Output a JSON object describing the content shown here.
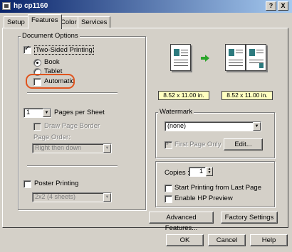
{
  "window": {
    "title": "hp cp1160",
    "help_button": "?",
    "close_button": "X"
  },
  "tabs": [
    {
      "label": "Setup",
      "active": false
    },
    {
      "label": "Features",
      "active": true
    },
    {
      "label": "Color",
      "active": false
    },
    {
      "label": "Services",
      "active": false
    }
  ],
  "document_options": {
    "legend": "Document Options",
    "two_sided_label": "Two-Sided Printing",
    "two_sided_checked": true,
    "book_label": "Book",
    "tablet_label": "Tablet",
    "automatic_label": "Automatic",
    "pages_per_sheet_value": "1",
    "pages_per_sheet_label": "Pages per Sheet",
    "draw_borders_label": "Draw Page Border",
    "page_order_label": "Page Order:",
    "page_order_value": "Right then down",
    "poster_label": "Poster Printing",
    "poster_value": "2x2 (4 sheets)"
  },
  "preview": {
    "size_left": "8.52 x 11.00 in.",
    "size_right": "8.52 x 11.00 in.",
    "arrow_color": "#2aa52a",
    "highlight_color": "#e0541e"
  },
  "watermark": {
    "legend": "Watermark",
    "value": "(none)",
    "first_page_label": "First Page Only",
    "edit_label": "Edit..."
  },
  "copies": {
    "label": "Copies :",
    "value": "1",
    "start_last_label": "Start Printing from Last Page",
    "hp_preview_label": "Enable HP Preview"
  },
  "buttons": {
    "advanced": "Advanced Features...",
    "factory": "Factory Settings",
    "ok": "OK",
    "cancel": "Cancel",
    "help": "Help"
  }
}
